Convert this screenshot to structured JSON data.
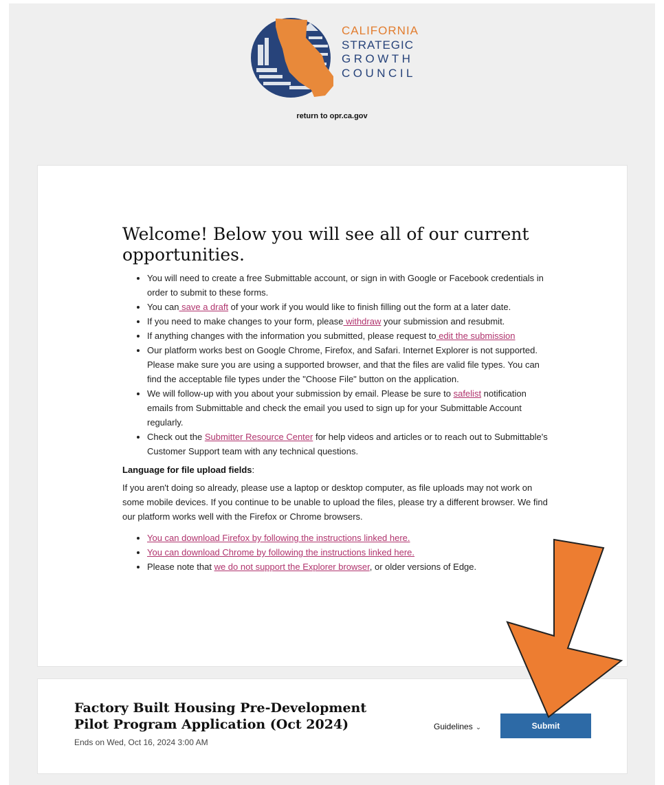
{
  "header": {
    "logo_lines": [
      "CALIFORNIA",
      "STRATEGIC",
      "GROWTH",
      "COUNCIL"
    ],
    "return_link": "return to opr.ca.gov"
  },
  "welcome": {
    "title": "Welcome! Below you will see all of our current opportunities.",
    "bullets": {
      "b1": "You will need to create a free Submittable account, or sign in with Google or Facebook credentials in order to submit to these forms.",
      "b2_pre": "You can",
      "b2_link": " save a draft",
      "b2_post": " of your work if you would like to finish filling out the form at a later date.",
      "b3_pre": "If you need to make changes to your form, please",
      "b3_link": " withdraw",
      "b3_post": " your submission and resubmit.",
      "b4_pre": "If anything changes with the information you submitted, please request to",
      "b4_link": " edit the submission",
      "b5": "Our platform works best on Google Chrome, Firefox, and Safari. Internet Explorer is not supported. Please make sure you are using a supported browser, and that the files are valid file types. You can find the acceptable file types under the \"Choose File\" button on the application.",
      "b6_pre": "We will follow-up with you about your submission by email. Please be sure to ",
      "b6_link": "safelist",
      "b6_post": " notification emails from Submittable and check the email you used to sign up for your Submittable Account regularly.",
      "b7_pre": "Check out the ",
      "b7_link": "Submitter Resource Center",
      "b7_post": " for help videos and articles or to reach out to Submittable's Customer Support team with any technical questions."
    },
    "lang_heading": "Language for file upload fields",
    "lang_colon": ":",
    "lang_para": "If you aren't doing so already, please use a laptop or desktop computer, as file uploads may not work on some mobile devices. If you continue to be unable to upload the files, please try a different browser. We find our platform works well with the Firefox or Chrome browsers.",
    "links": {
      "firefox": "You can download Firefox by following the instructions linked here.",
      "chrome": "You can download Chrome by following the instructions linked here.",
      "edge_pre": "Please note that ",
      "edge_link": "we do not support the Explorer browser",
      "edge_post": ", or older versions of Edge."
    }
  },
  "opportunity": {
    "title": "Factory Built Housing Pre-Development Pilot Program Application (Oct 2024)",
    "ends": "Ends on Wed, Oct 16, 2024 3:00 AM",
    "guidelines_label": "Guidelines",
    "submit_label": "Submit"
  },
  "colors": {
    "accent_orange": "#e27d2f",
    "navy": "#27437a",
    "link_pink": "#b0336d",
    "submit_blue": "#2d6aa6"
  }
}
